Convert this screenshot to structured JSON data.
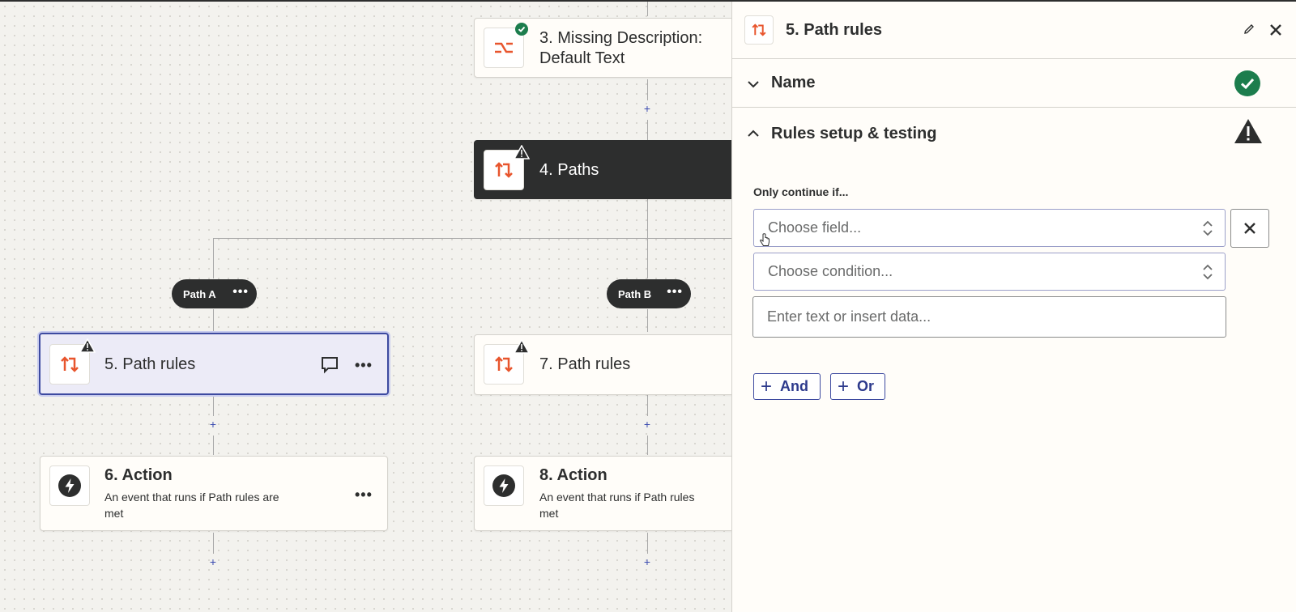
{
  "canvas": {
    "nodes": {
      "step3": {
        "title_line1": "3. Missing Description:",
        "title_line2": "Default Text"
      },
      "step4": {
        "title": "4. Paths"
      },
      "step5": {
        "title": "5. Path rules"
      },
      "step7": {
        "title": "7. Path rules"
      },
      "step6": {
        "title": "6. Action",
        "description_line1": "An event that runs if Path rules are",
        "description_line2": "met"
      },
      "step8": {
        "title": "8. Action",
        "description_line1": "An event that runs if Path rules",
        "description_line2": "met"
      }
    },
    "paths": {
      "a": {
        "label": "Path A"
      },
      "b": {
        "label": "Path B"
      }
    },
    "plus_symbol": "+",
    "dots_symbol": "•••"
  },
  "panel": {
    "title": "5. Path rules",
    "sections": {
      "name": {
        "title": "Name",
        "status": "complete"
      },
      "rules": {
        "title": "Rules setup & testing",
        "status": "warning"
      }
    },
    "form": {
      "label": "Only continue if...",
      "field_placeholder": "Choose field...",
      "condition_placeholder": "Choose condition...",
      "value_placeholder": "Enter text or insert data...",
      "and_label": "And",
      "or_label": "Or",
      "plus_symbol": "+"
    }
  },
  "colors": {
    "accent": "#3d4aa0",
    "paths_orange": "#e8552d",
    "success_green": "#1c7d4d",
    "dark": "#2d2e2e"
  }
}
